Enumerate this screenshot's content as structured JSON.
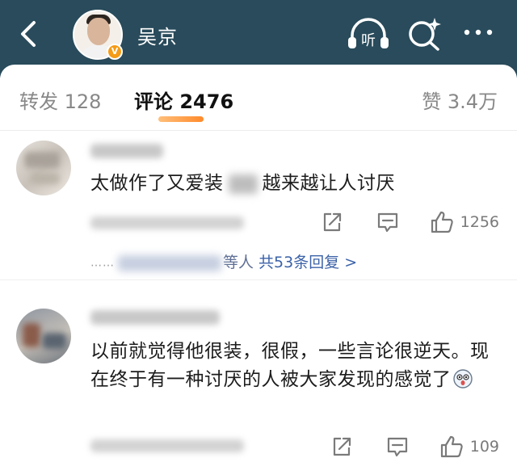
{
  "header": {
    "title": "吴京",
    "verified_badge": "V",
    "icons": [
      "back-icon",
      "listen-icon",
      "search-icon",
      "more-icon"
    ],
    "listen_label": "听",
    "background_color": "#294b5b"
  },
  "tabs": {
    "repost": "转发 128",
    "comment": "评论 2476",
    "like": "赞 3.4万",
    "active": "comment",
    "accent_color": "#ff8a2b"
  },
  "comments": [
    {
      "text_before": "太做作了又爱装",
      "text_after": "越来越让人讨厌",
      "likes": "1256",
      "replies_suffix": "等人",
      "replies_link": "共53条回复 >"
    },
    {
      "text": "以前就觉得他很装，很假，一些言论很逆天。现在终于有一种讨厌的人被大家发现的感觉了",
      "emoji": "shocked-face-emoji",
      "likes": "109"
    }
  ],
  "replies_dots": "……",
  "link_color": "#3b62a8"
}
